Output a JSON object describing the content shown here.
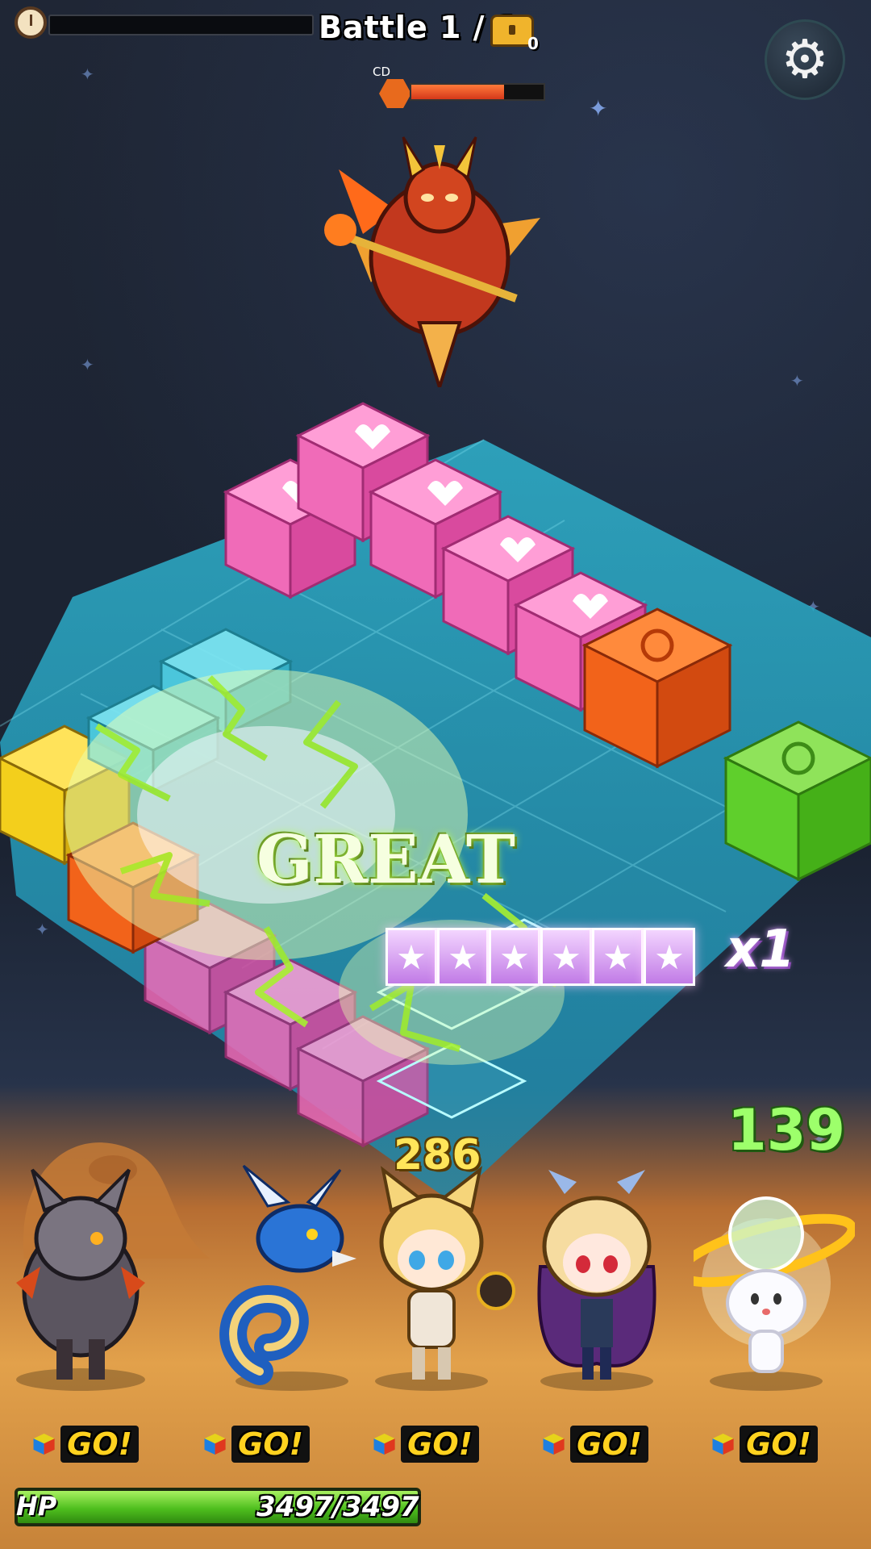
{
  "hud": {
    "battle_label": "Battle 1 / 1",
    "chest_count": "0",
    "cd_label": "CD",
    "cd_fill": 0.7,
    "timer_fill": 0.0
  },
  "icons": {
    "timer": "alarm-clock-icon",
    "chest": "treasure-chest-icon",
    "settings": "gear-icon",
    "cooldown": "fire-element-icon"
  },
  "board": {
    "effect_text": "GREAT",
    "star_tiles": [
      "★",
      "★",
      "★",
      "★",
      "★",
      "★"
    ],
    "multiplier": "x1"
  },
  "damage": {
    "numbers": [
      "286",
      "139"
    ]
  },
  "party": {
    "heroes": [
      {
        "name": "wolf-warrior-hero",
        "element": "fire"
      },
      {
        "name": "blue-dragon-hero",
        "element": "water"
      },
      {
        "name": "cat-girl-hero",
        "element": "light"
      },
      {
        "name": "vampire-girl-hero",
        "element": "dark"
      },
      {
        "name": "planet-spirit-hero",
        "element": "light"
      }
    ],
    "go_label": "GO!"
  },
  "hp": {
    "label": "HP",
    "value": "3497/3497",
    "fill": 1.0
  },
  "colors": {
    "pink_block": "#f56bb8",
    "orange_block": "#f2631a",
    "green_block": "#5fcf2c",
    "yellow_block": "#f3cf1c",
    "cyan_block": "#4fcce0",
    "board_tile": "#2aa7c4",
    "hp_green": "#4fbf1e",
    "go_yellow": "#ffd21f"
  }
}
